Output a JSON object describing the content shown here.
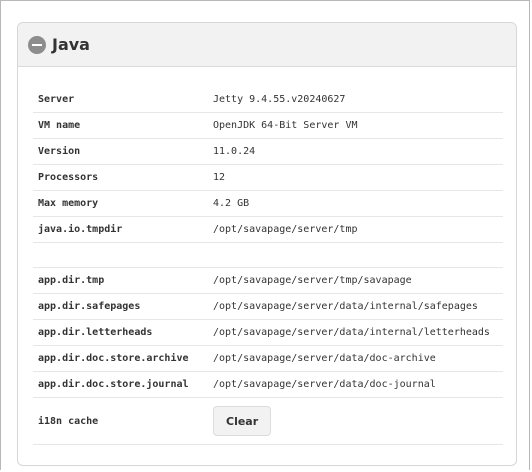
{
  "panel": {
    "title": "Java",
    "collapse_icon": "minus-circle-icon"
  },
  "rows": [
    {
      "key": "Server",
      "value": "Jetty 9.4.55.v20240627"
    },
    {
      "key": "VM name",
      "value": "OpenJDK 64-Bit Server VM"
    },
    {
      "key": "Version",
      "value": "11.0.24"
    },
    {
      "key": "Processors",
      "value": "12"
    },
    {
      "key": "Max memory",
      "value": "4.2 GB"
    },
    {
      "key": "java.io.tmpdir",
      "value": "/opt/savapage/server/tmp"
    }
  ],
  "dir_rows": [
    {
      "key": "app.dir.tmp",
      "value": "/opt/savapage/server/tmp/savapage"
    },
    {
      "key": "app.dir.safepages",
      "value": "/opt/savapage/server/data/internal/safepages"
    },
    {
      "key": "app.dir.letterheads",
      "value": "/opt/savapage/server/data/internal/letterheads"
    },
    {
      "key": "app.dir.doc.store.archive",
      "value": "/opt/savapage/server/data/doc-archive"
    },
    {
      "key": "app.dir.doc.store.journal",
      "value": "/opt/savapage/server/data/doc-journal"
    }
  ],
  "i18n": {
    "label": "i18n cache",
    "clear_label": "Clear"
  }
}
